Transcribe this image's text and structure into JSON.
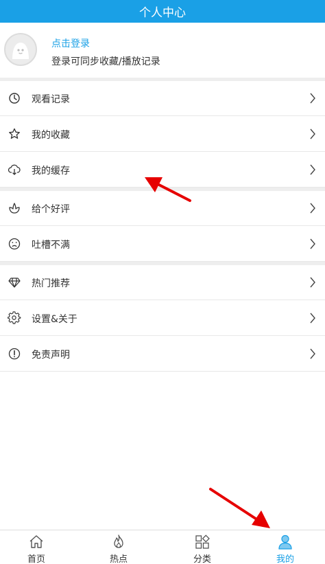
{
  "header": {
    "title": "个人中心"
  },
  "profile": {
    "login_link": "点击登录",
    "login_subtitle": "登录可同步收藏/播放记录"
  },
  "menu": {
    "items": [
      {
        "label": "观看记录",
        "icon": "clock-icon"
      },
      {
        "label": "我的收藏",
        "icon": "star-icon"
      },
      {
        "label": "我的缓存",
        "icon": "cloud-download-icon"
      },
      {
        "label": "给个好评",
        "icon": "flower-icon"
      },
      {
        "label": "吐槽不满",
        "icon": "sad-face-icon"
      },
      {
        "label": "热门推荐",
        "icon": "diamond-icon"
      },
      {
        "label": "设置&关于",
        "icon": "gear-icon"
      },
      {
        "label": "免责声明",
        "icon": "exclamation-icon"
      }
    ]
  },
  "tabbar": {
    "tabs": [
      {
        "label": "首页",
        "icon": "home-icon",
        "active": false
      },
      {
        "label": "热点",
        "icon": "flame-icon",
        "active": false
      },
      {
        "label": "分类",
        "icon": "category-icon",
        "active": false
      },
      {
        "label": "我的",
        "icon": "user-icon",
        "active": true
      }
    ]
  },
  "colors": {
    "accent": "#1aa0e6",
    "annotation_arrow": "#e60000"
  }
}
